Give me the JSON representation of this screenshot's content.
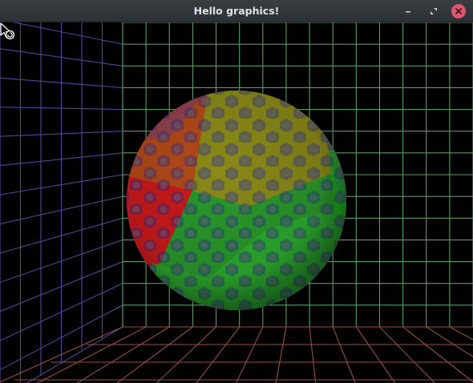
{
  "window": {
    "title": "Hello graphics!"
  },
  "titlebar_buttons": [
    {
      "name": "minimize-button",
      "icon": "minimize-icon"
    },
    {
      "name": "maximize-button",
      "icon": "maximize-icon"
    },
    {
      "name": "close-button",
      "icon": "close-icon"
    }
  ],
  "scene": {
    "left_wall_color": "#4b4a9a",
    "back_wall_color": "#5a9a62",
    "floor_color": "#9a4a4a",
    "sphere_colors": [
      "#e01818",
      "#c45a18",
      "#8a8a10",
      "#22c022",
      "#2020c0"
    ],
    "cursor_icon": "busy-pointer-icon"
  }
}
